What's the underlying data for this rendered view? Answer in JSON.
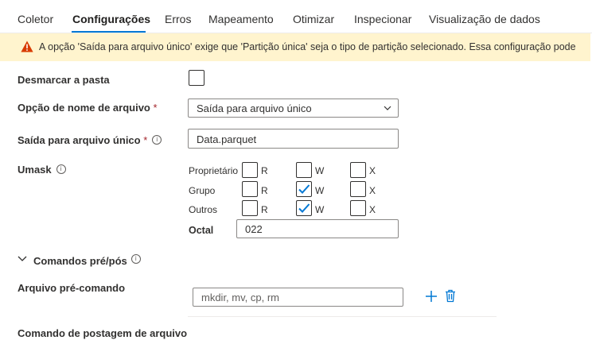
{
  "tabs": [
    {
      "label": "Coletor",
      "active": false
    },
    {
      "label": "Configurações",
      "active": true
    },
    {
      "label": "Erros",
      "active": false
    },
    {
      "label": "Mapeamento",
      "active": false
    },
    {
      "label": "Otimizar",
      "active": false
    },
    {
      "label": "Inspecionar",
      "active": false
    },
    {
      "label": "Visualização de dados",
      "active": false
    }
  ],
  "warning": {
    "icon": "warning-icon",
    "text": "A opção 'Saída para arquivo único' exige que 'Partição única' seja o tipo de partição selecionado. Essa configuração pode"
  },
  "form": {
    "clear_folder": {
      "label": "Desmarcar a pasta",
      "checked": false
    },
    "file_name_option": {
      "label": "Opção de nome de arquivo",
      "required": "*",
      "value": "Saída para arquivo único"
    },
    "single_file": {
      "label": "Saída para arquivo único",
      "required": "*",
      "value": "Data.parquet"
    },
    "umask": {
      "label": "Umask",
      "rows": [
        {
          "label": "Proprietário",
          "r": false,
          "w": false,
          "x": false
        },
        {
          "label": "Grupo",
          "r": false,
          "w": true,
          "x": false
        },
        {
          "label": "Outros",
          "r": false,
          "w": true,
          "x": false
        }
      ],
      "col_labels": {
        "r": "R",
        "w": "W",
        "x": "X"
      },
      "octal_label": "Octal",
      "octal_value": "022"
    },
    "pre_post": {
      "label": "Comandos pré/pós"
    },
    "pre_command": {
      "label": "Arquivo pré-comando",
      "placeholder": "mkdir, mv, cp, rm"
    },
    "post_command": {
      "label": "Comando de postagem de arquivo"
    }
  },
  "colors": {
    "accent": "#0078d4",
    "warning_bg": "#fff4ce",
    "warning_icon": "#d83b01",
    "required": "#a4262c"
  }
}
